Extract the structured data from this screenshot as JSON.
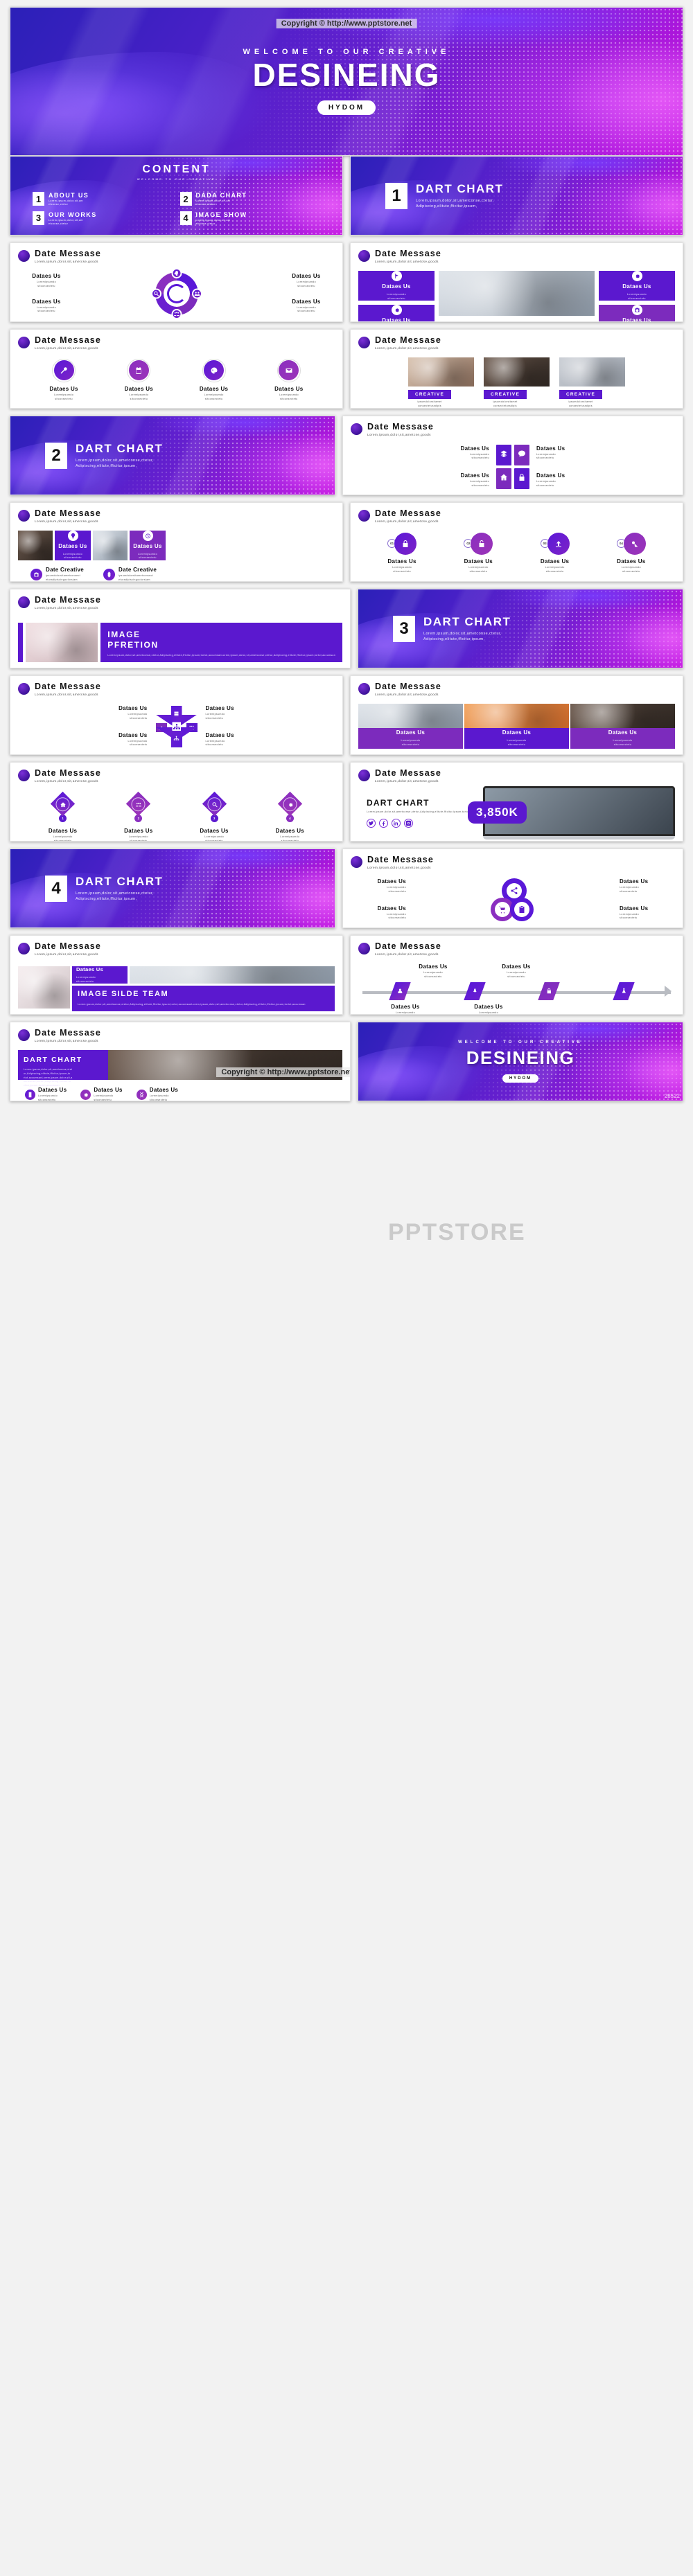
{
  "watermark": {
    "top": "Copyright © http://www.pptstore.net",
    "bottom": "Copyright © http://www.pptstore.net",
    "center": "PPTSTORE",
    "code": "28522"
  },
  "hero": {
    "kicker": "WELCOME  TO  OUR  CREATIVE",
    "title": "DESINEING",
    "badge": "HYDOM"
  },
  "content_slide": {
    "title": "CONTENT",
    "subtitle": "WELCOME TO OUR  CREATIVE",
    "items": [
      {
        "num": "1",
        "label": "ABOUT US",
        "desc": "Lorem,ipsum,dolor,sit,am\netconse,ctetur"
      },
      {
        "num": "2",
        "label": "DADA CHART",
        "desc": "Lorem,ipsum,dolor,sit,am\netconse,ctetur"
      },
      {
        "num": "3",
        "label": "OUR WORKS",
        "desc": "Lorem,ipsum,dolor,sit,am\netconse,ctetur"
      },
      {
        "num": "4",
        "label": "IMAGE SHOW",
        "desc": "Lorem,ipsum,dolor,sit,am\netconse,ctetur"
      }
    ]
  },
  "sections": [
    {
      "num": "1",
      "title": "DART CHART",
      "desc": "Lorem,ipsum,dolor,sit,ametconse,ctetur,\nAdipiscing,elitute,fficitur,ipsum,"
    },
    {
      "num": "2",
      "title": "DART CHART",
      "desc": "Lorem,ipsum,dolor,sit,ametconse,ctetur,\nAdipiscing,elitute,fficitur,ipsum,"
    },
    {
      "num": "3",
      "title": "DART CHART",
      "desc": "Lorem,ipsum,dolor,sit,ametconse,ctetur,\nAdipiscing,elitute,fficitur,ipsum,"
    },
    {
      "num": "4",
      "title": "DART CHART",
      "desc": "Lorem,ipsum,dolor,sit,ametconse,ctetur,\nAdipiscing,elitute,fficitur,ipsum,"
    }
  ],
  "header": {
    "title": "Date Messase",
    "subtitle": "Lorem,ipsum,dolor,sit,ametcse,goods"
  },
  "labels": {
    "dataes": "Dataes Us",
    "dataes_desc": "Loremipsumdo\nsitconsectetu",
    "creative": "CREATIVE",
    "creative_desc": "ipsumdolorsitamet\nconsecteturadipis\ncingsolorsiam",
    "date_creative": "Date  Creative",
    "date_creative_desc": "ipsumdolorsitametconsect\neturadipiscingoolorsiam"
  },
  "image_pfretion": {
    "title": "IMAGE\nPFRETION",
    "desc": "Lorem,ipsum,dolor,sit,ametconse,ctetur,Adipiscing,elitute,fficitur,ipsum,tortot,accumsanLorem,ipsum,dolor,sit,ametconse,ctetur,Adipiscing,elitute,fficitur,ipsum,tortot,accumsan"
  },
  "image_team": {
    "title": "IMAGE SILDE TEAM",
    "desc": "Lorem,ipsum,dolor,sit,ametsonse,ctetur,Adipiscing,elitute,fficitur,ipsum,tortot,accumsanLorem,ipsum,dolor,sit,ametconse,ctetur,Adipiscing,elitute,fficitur,ipsum,tortot,accumsan"
  },
  "dart_kpi": {
    "title": "DART CHART",
    "desc": "Lorem,ipsum,dolor,sit,ametconse,ctetur,Adipiscing,elitute,fficitur,ipsum,tortot,accumsanLorem,ipsum,dolor,sit,ametconse,ctetur,Adipiscing,elitute,fficitur,ipsum,tortot,accumsan",
    "value": "3,850K",
    "socials": [
      "twitter-icon",
      "facebook-icon",
      "linkedin-icon",
      "instagram-icon"
    ]
  },
  "dart_photo": {
    "title": "DART CHART",
    "desc": "Lorem,ipsum,dolor,sit,ametconse,ctet\nur,Adipiscing,elitute,fficitur,ipsum,to\nrtot,accumsanLorem,ipsum,dolor,sit,a\nmetconse,ctetur,Adipiscing,elitute,ffi\ncitur,ipsum,tortot,accumsan"
  },
  "step_numbers": [
    "01",
    "02",
    "03",
    "04"
  ],
  "diamond_numbers": [
    "1",
    "2",
    "3",
    "4"
  ],
  "colors": {
    "accent": "#5b18cf",
    "accent_alt": "#7c2bbd",
    "deep": "#2b20b8",
    "magenta": "#c313e0"
  },
  "icons": {
    "cycle": [
      "brain-icon",
      "group-icon",
      "search-icon",
      "people-icon"
    ],
    "tiles4": [
      "flag-icon",
      "gear-icon",
      "gear-icon",
      "camera-icon"
    ],
    "circles4": [
      "wrench-icon",
      "calendar-icon",
      "palette-icon",
      "mail-icon"
    ],
    "grid4": [
      "layers-icon",
      "chat-icon",
      "home-icon",
      "lock-icon"
    ],
    "photo_overlay": [
      "bulb-icon",
      "clock-icon"
    ],
    "steps4": [
      "lock-icon",
      "unlock-icon",
      "upload-icon",
      "key-icon"
    ],
    "diamond4": [
      "home-icon",
      "people-icon",
      "search-icon",
      "gear-icon"
    ],
    "rhombus4": [
      "server-icon",
      "edit-icon",
      "sitemap-icon",
      "keypad-icon",
      "hierarchy-icon"
    ],
    "venn3": [
      "share-icon",
      "cart-icon",
      "clipboard-icon"
    ],
    "flow4": [
      "user-icon",
      "rocket-icon",
      "lock-icon",
      "flask-icon"
    ],
    "bottom3": [
      "phone-icon",
      "gear-icon",
      "dna-icon"
    ],
    "date_creative": [
      "camera-icon",
      "watch-icon"
    ]
  }
}
